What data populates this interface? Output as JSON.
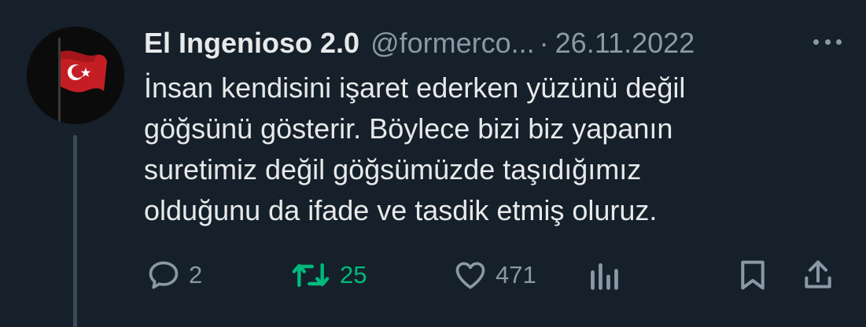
{
  "tweet": {
    "author_name": "El Ingenioso 2.0",
    "handle": "@formerco...",
    "separator": "·",
    "date": "26.11.2022",
    "text_lines": [
      "İnsan kendisini işaret ederken yüzünü değil",
      "göğsünü gösterir. Böylece bizi biz yapanın",
      "suretimiz değil göğsümüzde taşıdığımız",
      "olduğunu da ifade ve tasdik etmiş oluruz."
    ]
  },
  "actions": {
    "replies": "2",
    "retweets": "25",
    "likes": "471"
  },
  "icons": {
    "avatar": "turkish-flag-avatar",
    "more": "more-horizontal-icon",
    "reply": "speech-bubble-icon",
    "retweet": "retweet-arrows-icon",
    "like": "heart-icon",
    "views": "bar-chart-icon",
    "bookmark": "bookmark-icon",
    "share": "share-upload-icon"
  },
  "colors": {
    "background": "#15202b",
    "text": "#e7e9ea",
    "muted": "#8b98a5",
    "retweet_green": "#00ba7c",
    "thread_line": "#3c4a57"
  }
}
